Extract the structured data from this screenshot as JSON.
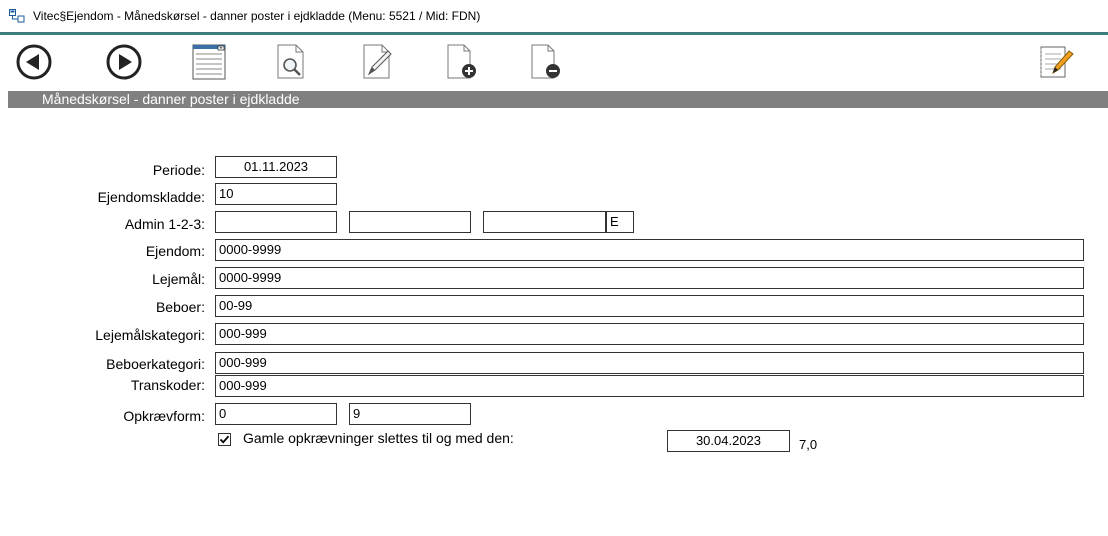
{
  "window": {
    "title": "Vitec§Ejendom - Månedskørsel - danner poster i ejdkladde (Menu: 5521 / Mid: FDN)"
  },
  "toolbar": {
    "buttons": [
      {
        "name": "back-button",
        "icon": "arrow-left-circle-icon"
      },
      {
        "name": "forward-button",
        "icon": "arrow-right-circle-icon"
      },
      {
        "name": "list-view-button",
        "icon": "list-dropdown-icon"
      },
      {
        "name": "search-document-button",
        "icon": "magnifier-document-icon"
      },
      {
        "name": "edit-document-button",
        "icon": "pencil-icon"
      },
      {
        "name": "add-document-button",
        "icon": "document-plus-icon"
      },
      {
        "name": "remove-document-button",
        "icon": "document-minus-icon"
      },
      {
        "name": "notepad-button",
        "icon": "notepad-pencil-icon"
      }
    ]
  },
  "section": {
    "title": "Månedskørsel - danner poster i ejdkladde"
  },
  "form": {
    "periode": {
      "label": "Periode:",
      "value": "01.11.2023"
    },
    "ejendomskladde": {
      "label": "Ejendomskladde:",
      "value": "10"
    },
    "admin": {
      "label": "Admin 1-2-3:",
      "value1": "",
      "value2": "",
      "value3": "",
      "suffix": "E"
    },
    "ejendom": {
      "label": "Ejendom:",
      "value": "0000-9999"
    },
    "lejemaal": {
      "label": "Lejemål:",
      "value": "0000-9999"
    },
    "beboer": {
      "label": "Beboer:",
      "value": "00-99"
    },
    "lejemaalskategori": {
      "label": "Lejemålskategori:",
      "value": "000-999"
    },
    "beboerkategori": {
      "label": "Beboerkategori:",
      "value": "000-999"
    },
    "transkoder": {
      "label": "Transkoder:",
      "value": "000-999"
    },
    "opkraevform": {
      "label": "Opkrævform:",
      "from": "0",
      "to": "9"
    },
    "gamle": {
      "checked": true,
      "label": "Gamle opkrævninger slettes til og med den:",
      "date": "30.04.2023",
      "extra": "7,0"
    }
  },
  "colors": {
    "accent": "#3a7d7f",
    "section_bar": "#808080"
  }
}
